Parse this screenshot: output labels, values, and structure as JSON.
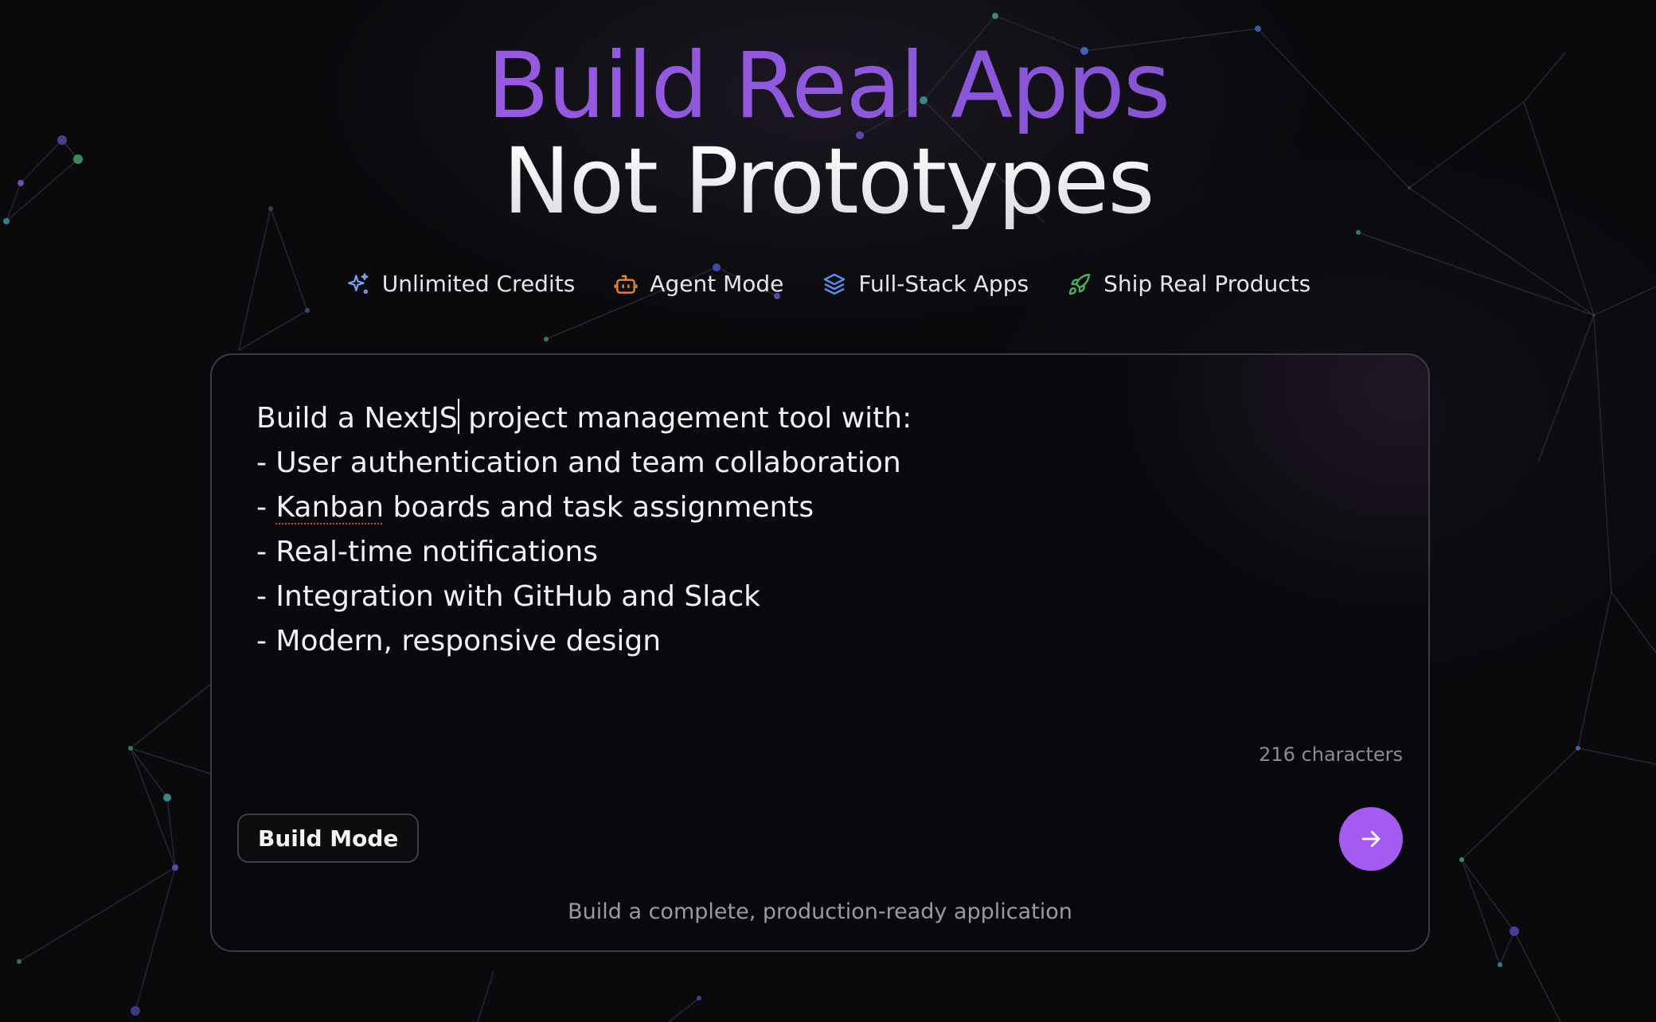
{
  "hero": {
    "accent_line": "Build Real Apps",
    "main_line": "Not Prototypes"
  },
  "features": [
    {
      "label": "Unlimited Credits",
      "icon": "sparkles-icon",
      "color": "#7aa6e8"
    },
    {
      "label": "Agent Mode",
      "icon": "robot-icon",
      "color": "#e8843a"
    },
    {
      "label": "Full-Stack Apps",
      "icon": "layers-icon",
      "color": "#5b8ef0"
    },
    {
      "label": "Ship Real Products",
      "icon": "rocket-icon",
      "color": "#4cae62"
    }
  ],
  "prompt": {
    "line1_before_caret": "Build a NextJS",
    "line1_after_caret": " project management tool with:",
    "line2": "- User authentication and team collaboration",
    "line3_prefix": "- ",
    "line3_flagged": "Kanban",
    "line3_suffix": " boards and task assignments",
    "line4": "- Real-time notifications",
    "line5": "- Integration with GitHub and Slack",
    "line6": "- Modern, responsive design"
  },
  "char_count": "216 characters",
  "mode_button": "Build Mode",
  "send_button_icon": "arrow-right-icon",
  "hint": "Build a complete, production-ready application",
  "colors": {
    "accent": "#a45cf0",
    "background": "#0a0a0d",
    "card_border": "#3b3b42"
  }
}
